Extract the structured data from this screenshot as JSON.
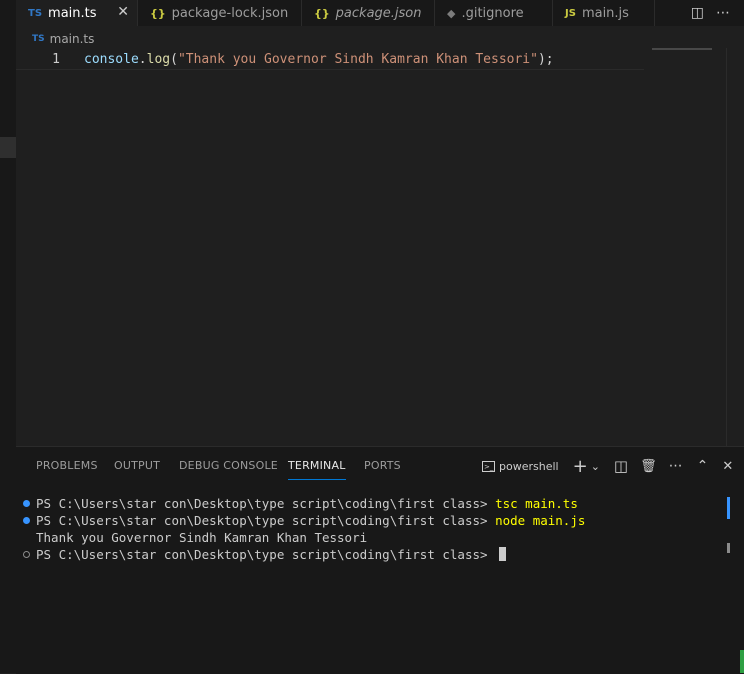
{
  "tabs": [
    {
      "icon": "TS",
      "label": "main.ts",
      "close": "✕"
    },
    {
      "icon": "{}",
      "label": "package-lock.json"
    },
    {
      "icon": "{}",
      "label": "package.json"
    },
    {
      "icon": "◆",
      "label": ".gitignore"
    },
    {
      "icon": "JS",
      "label": "main.js"
    }
  ],
  "tab_actions": {
    "split": "◫",
    "more": "⋯"
  },
  "breadcrumb": {
    "icon": "TS",
    "label": "main.ts"
  },
  "editor": {
    "line_number": "1",
    "code": {
      "object": "console",
      "dot": ".",
      "method": "log",
      "open": "(",
      "string": "\"Thank you Governor Sindh Kamran Khan Tessori\"",
      "close": ");"
    }
  },
  "panel": {
    "tabs": [
      "PROBLEMS",
      "OUTPUT",
      "DEBUG CONSOLE",
      "TERMINAL",
      "PORTS"
    ],
    "shell_label": "powershell",
    "tools": {
      "add": "+",
      "dropdown": "⌄",
      "split": "◫",
      "trash": "🗑",
      "more": "⋯",
      "maximize": "⌃",
      "close": "✕"
    }
  },
  "terminal": {
    "prompt": "PS C:\\Users\\star con\\Desktop\\type script\\coding\\first class> ",
    "lines": [
      {
        "cmd": "tsc main.ts"
      },
      {
        "cmd": "node main.js"
      },
      {
        "output": "Thank you Governor Sindh Kamran Khan Tessori"
      }
    ]
  },
  "colors": {
    "accent": "#0078d4",
    "ts_icon": "#3178c6",
    "json_icon": "#cbcb41",
    "command": "#ffff00",
    "string": "#ce9178"
  }
}
